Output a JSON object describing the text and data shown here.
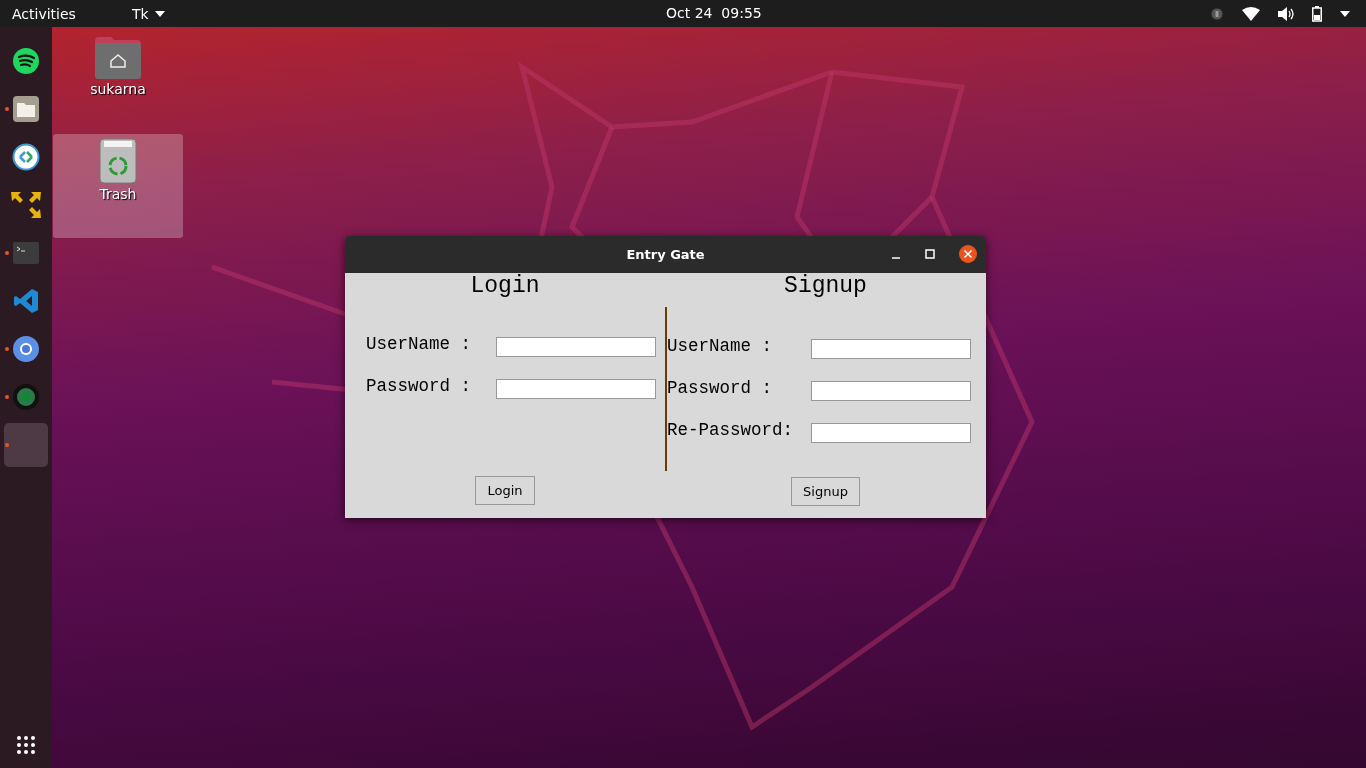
{
  "top_bar": {
    "activities": "Activities",
    "app_menu": "Tk",
    "clock": "Oct 24  09:55"
  },
  "dock": {
    "items": [
      {
        "kind": "music",
        "running": false,
        "selected": false
      },
      {
        "kind": "files",
        "running": true,
        "selected": false
      },
      {
        "kind": "remote",
        "running": false,
        "selected": false
      },
      {
        "kind": "arrows",
        "running": false,
        "selected": false
      },
      {
        "kind": "terminal",
        "running": true,
        "selected": false
      },
      {
        "kind": "editor",
        "running": false,
        "selected": false
      },
      {
        "kind": "browser",
        "running": true,
        "selected": false
      },
      {
        "kind": "camera",
        "running": true,
        "selected": false
      },
      {
        "kind": "blank",
        "running": true,
        "selected": true
      }
    ]
  },
  "desktop_icons": [
    {
      "kind": "home",
      "label": "sukarna",
      "selected": false
    },
    {
      "kind": "trash",
      "label": "Trash",
      "selected": true
    }
  ],
  "window": {
    "title": "Entry Gate",
    "login": {
      "heading": "Login",
      "fields": [
        {
          "label": "UserName :"
        },
        {
          "label": "Password :"
        }
      ],
      "button": "Login"
    },
    "signup": {
      "heading": "Signup",
      "fields": [
        {
          "label": "UserName :"
        },
        {
          "label": "Password :"
        },
        {
          "label": "Re-Password:"
        }
      ],
      "button": "Signup"
    }
  }
}
